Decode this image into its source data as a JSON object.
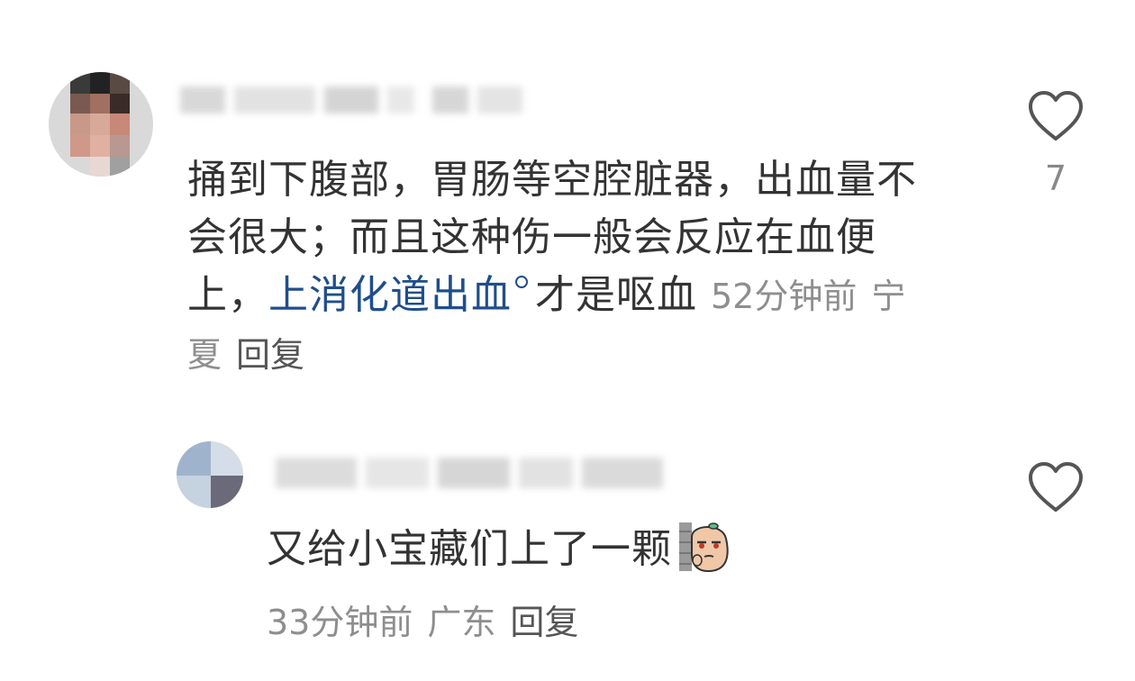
{
  "comments": [
    {
      "text_before_link": "捅到下腹部，胃肠等空腔脏器，出血量不会很大；而且这种伤一般会反应在血便上，",
      "link_text": "上消化道出血",
      "text_after_link": "才是呕血",
      "time": "52分钟前",
      "location": "宁夏",
      "reply_label": "回复",
      "like_count": "7",
      "like_icon": "heart-outline-icon"
    },
    {
      "text": "又给小宝藏们上了一颗",
      "sticker": "peeking-peanut-sticker",
      "time": "33分钟前",
      "location": "广东",
      "reply_label": "回复",
      "like_icon": "heart-outline-icon"
    }
  ],
  "colors": {
    "text": "#333333",
    "meta": "#8e8e8e",
    "link": "#1f4e8c",
    "icon": "#555555"
  }
}
